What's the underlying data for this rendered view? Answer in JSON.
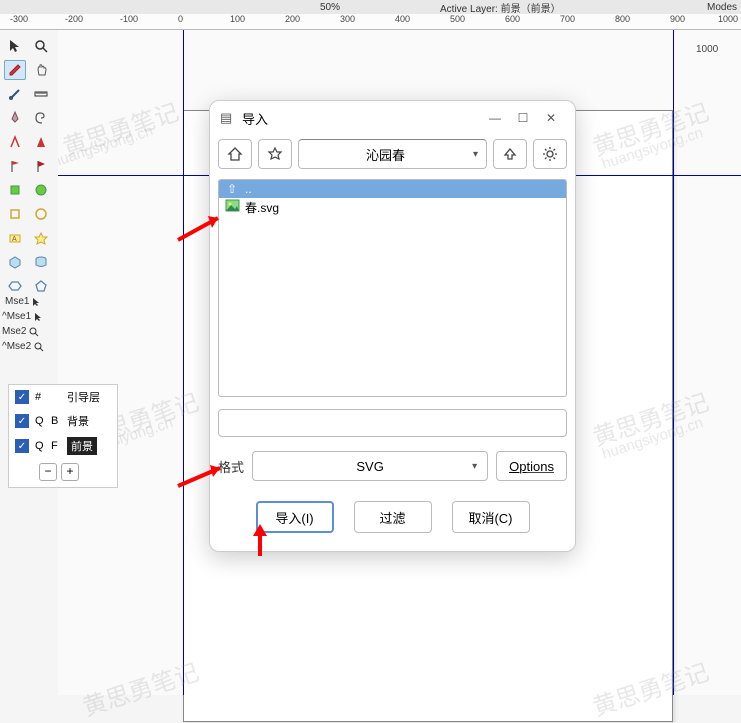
{
  "topinfo": {
    "zoom": "50%",
    "active_layer_label": "Active Layer:",
    "active_layer_value": "前景（前景）",
    "modes": "Modes"
  },
  "ruler_ticks": [
    "-300",
    "-200",
    "-100",
    "0",
    "100",
    "200",
    "300",
    "400",
    "500",
    "600",
    "700",
    "800",
    "900",
    "1000"
  ],
  "ruler_side": "1000",
  "mouse_labels": [
    "Mse1",
    "^Mse1",
    "Mse2",
    "^Mse2"
  ],
  "layers": {
    "items": [
      {
        "col1": "#",
        "col2": "",
        "name": "引导层"
      },
      {
        "col1": "Q",
        "col2": "B",
        "name": "背景"
      },
      {
        "col1": "Q",
        "col2": "F",
        "name": "前景"
      }
    ],
    "minus": "−",
    "plus": "+"
  },
  "dialog": {
    "title": "导入",
    "path": "沁园春",
    "files": [
      {
        "icon": "⇧",
        "name": ".."
      },
      {
        "icon": "img",
        "name": "春.svg"
      }
    ],
    "format_label": "格式",
    "format_value": "SVG",
    "options": "Options",
    "import_btn": "导入(I)",
    "filter_btn": "过滤",
    "cancel_btn": "取消(C)"
  },
  "watermark_cn": "黄思勇笔记",
  "watermark_en": "huangsiyong.cn"
}
